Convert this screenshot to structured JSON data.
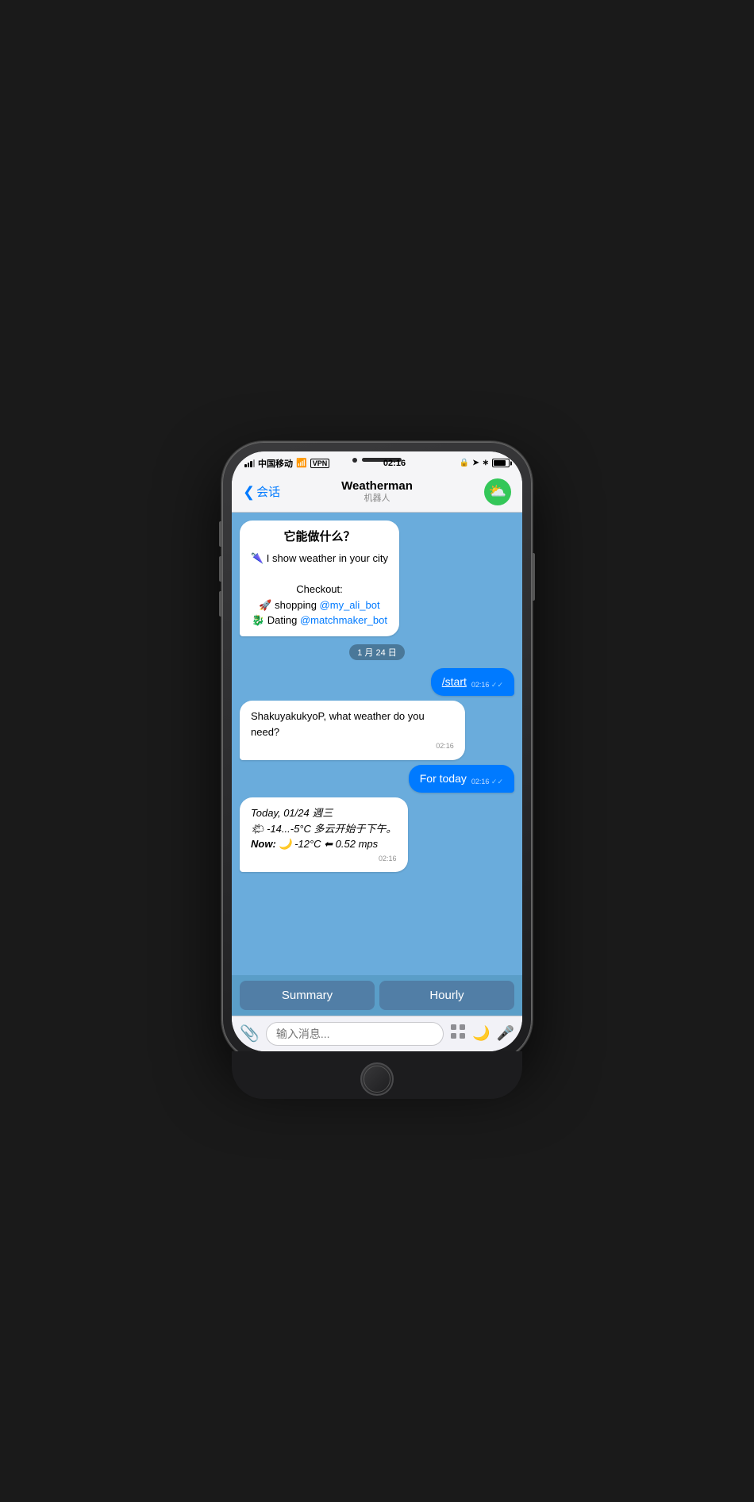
{
  "status": {
    "carrier": "中国移动",
    "wifi": "WiFi",
    "vpn": "VPN",
    "time": "02:16",
    "battery_pct": 85
  },
  "nav": {
    "back_label": "会话",
    "title": "Weatherman",
    "subtitle": "机器人"
  },
  "messages": [
    {
      "type": "bot",
      "style": "welcome",
      "title": "它能做什么？",
      "line1": "🌂 I show weather in your city",
      "line2": "Checkout:",
      "item1_emoji": "🚀",
      "item1_text": "shopping ",
      "item1_link": "@my_ali_bot",
      "item2_emoji": "🐉",
      "item2_text": "Dating ",
      "item2_link": "@matchmaker_bot"
    },
    {
      "type": "date",
      "label": "1 月 24 日"
    },
    {
      "type": "user",
      "text": "/start",
      "time": "02:16",
      "read": true,
      "double_check": true
    },
    {
      "type": "bot",
      "text": "ShakuyakukyoP, what weather do you need?",
      "time": "02:16"
    },
    {
      "type": "user",
      "text": "For today",
      "time": "02:16",
      "read": true,
      "double_check": true
    },
    {
      "type": "bot",
      "style": "weather",
      "line1": "Today, 01/24 週三",
      "line2": "🌤 -14...-5°C 多云开始于下午。",
      "line3": "Now: 🌙 -12°C ⬅ 0.52 mps",
      "time": "02:16"
    }
  ],
  "action_buttons": [
    {
      "label": "Summary"
    },
    {
      "label": "Hourly"
    }
  ],
  "input": {
    "placeholder": "输入消息..."
  }
}
